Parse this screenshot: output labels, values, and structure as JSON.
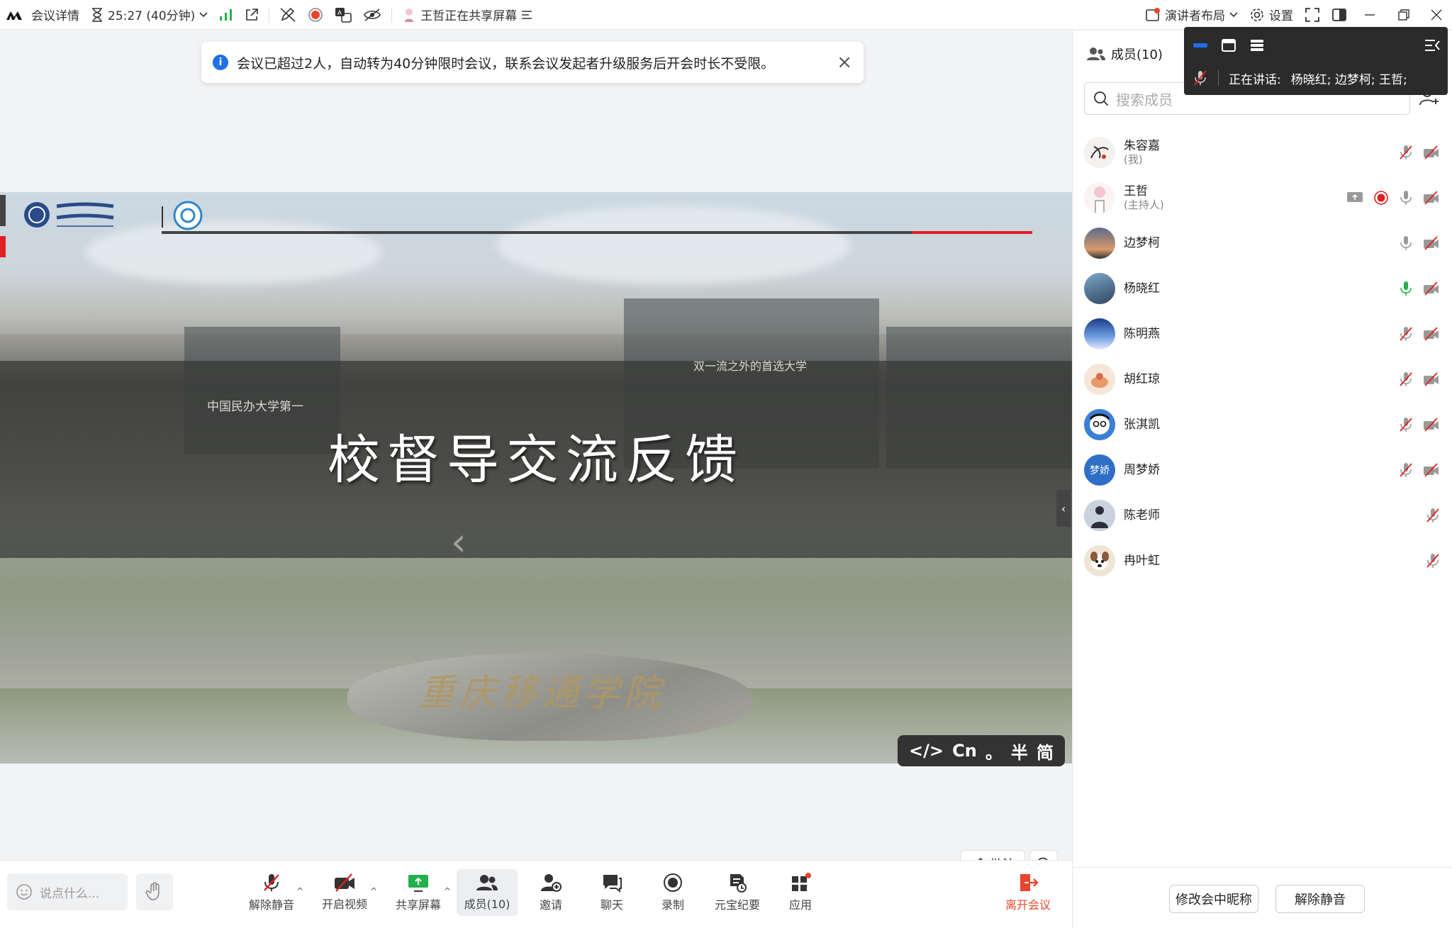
{
  "topbar": {
    "meeting_details": "会议详情",
    "timer": "25:27 (40分钟)",
    "sharing_status": "王哲正在共享屏幕",
    "layout": "演讲者布局",
    "settings": "设置"
  },
  "notice": {
    "text": "会议已超过2人，自动转为40分钟限时会议，联系会议发起者升级服务后开会时长不受限。"
  },
  "slide": {
    "title": "校督导交流反馈",
    "sub_left": "中国民办大学第一",
    "sub_right": "双一流之外的首选大学",
    "rock_text": "重庆移通学院"
  },
  "ime": {
    "code": "</>",
    "lang": "Cn",
    "punct": "。",
    "width": "半",
    "script": "简"
  },
  "annotate": {
    "label": "批注"
  },
  "toolbar": {
    "chat_placeholder": "说点什么...",
    "unmute": "解除静音",
    "video": "开启视频",
    "share": "共享屏幕",
    "members": "成员(10)",
    "invite": "邀请",
    "chat": "聊天",
    "record": "录制",
    "summary": "元宝纪要",
    "apps": "应用",
    "leave": "离开会议"
  },
  "sidebar": {
    "title": "成员(10)",
    "search_placeholder": "搜索成员",
    "members": [
      {
        "name": "朱容嘉",
        "role": "(我)",
        "mic": "muted",
        "video": "off"
      },
      {
        "name": "王哲",
        "role": "(主持人)",
        "mic": "on",
        "video": "off",
        "sharing": true,
        "recording": true
      },
      {
        "name": "边梦柯",
        "role": "",
        "mic": "on",
        "video": "off"
      },
      {
        "name": "杨晓红",
        "role": "",
        "mic": "speaking",
        "video": "off"
      },
      {
        "name": "陈明燕",
        "role": "",
        "mic": "muted",
        "video": "off"
      },
      {
        "name": "胡红琼",
        "role": "",
        "mic": "muted",
        "video": "off"
      },
      {
        "name": "张淇凯",
        "role": "",
        "mic": "muted",
        "video": "off"
      },
      {
        "name": "周梦娇",
        "role": "",
        "mic": "muted",
        "video": "off",
        "avatar_text": "梦娇"
      },
      {
        "name": "陈老师",
        "role": "",
        "mic": "muted"
      },
      {
        "name": "冉叶虹",
        "role": "",
        "mic": "muted"
      }
    ],
    "footer": {
      "rename": "修改会中昵称",
      "unmute_all": "解除静音"
    }
  },
  "floating": {
    "speaking_label": "正在讲话:",
    "speakers": "杨晓红; 边梦柯; 王哲;"
  },
  "colors": {
    "accent": "#1e6fe8",
    "speaking": "#22b14c",
    "danger": "#e02020",
    "leave": "#e8452c"
  }
}
